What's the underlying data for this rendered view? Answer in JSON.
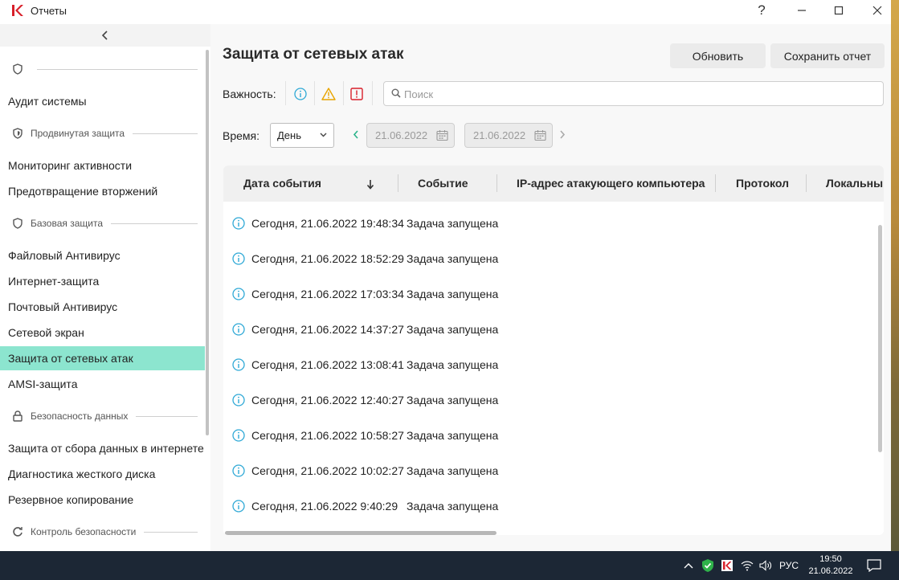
{
  "window": {
    "title": "Отчеты",
    "help": "?",
    "minimize": "—",
    "maximize": "☐",
    "close": "✕"
  },
  "sidebar": {
    "collapse_glyph": "‹",
    "top_section": {
      "label": "",
      "icon": "shield-icon"
    },
    "items": [
      {
        "id": "audit",
        "label": "Аудит системы"
      },
      {
        "id": "section-advanced",
        "section": true,
        "label": "Продвинутая защита",
        "icon": "shield-icon"
      },
      {
        "id": "activity",
        "label": "Мониторинг активности"
      },
      {
        "id": "intrusion",
        "label": "Предотвращение вторжений"
      },
      {
        "id": "section-basic",
        "section": true,
        "label": "Базовая защита",
        "icon": "shield-icon"
      },
      {
        "id": "file-av",
        "label": "Файловый Антивирус"
      },
      {
        "id": "web",
        "label": "Интернет-защита"
      },
      {
        "id": "mail-av",
        "label": "Почтовый Антивирус"
      },
      {
        "id": "firewall",
        "label": "Сетевой экран"
      },
      {
        "id": "network-attack",
        "label": "Защита от сетевых атак",
        "active": true
      },
      {
        "id": "amsi",
        "label": "AMSI-защита"
      },
      {
        "id": "section-data",
        "section": true,
        "label": "Безопасность данных",
        "icon": "lock-icon"
      },
      {
        "id": "data-collection",
        "label": "Защита от сбора данных в интернете"
      },
      {
        "id": "disk",
        "label": "Диагностика жесткого диска"
      },
      {
        "id": "backup",
        "label": "Резервное копирование"
      },
      {
        "id": "section-control",
        "section": true,
        "label": "Контроль безопасности",
        "icon": "refresh-shield-icon"
      }
    ]
  },
  "main": {
    "title": "Защита от сетевых атак",
    "refresh_label": "Обновить",
    "save_report_label": "Сохранить отчет",
    "severity_label": "Важность:",
    "search_placeholder": "Поиск",
    "time_label": "Время:",
    "period_value": "День",
    "date_from": "21.06.2022",
    "date_to": "21.06.2022"
  },
  "table": {
    "columns": [
      "Дата события",
      "Событие",
      "IP-адрес атакующего компьютера",
      "Протокол",
      "Локальный"
    ],
    "rows": [
      {
        "date": "Сегодня, 21.06.2022 19:48:34",
        "event": "Задача запущена"
      },
      {
        "date": "Сегодня, 21.06.2022 18:52:29",
        "event": "Задача запущена"
      },
      {
        "date": "Сегодня, 21.06.2022 17:03:34",
        "event": "Задача запущена"
      },
      {
        "date": "Сегодня, 21.06.2022 14:37:27",
        "event": "Задача запущена"
      },
      {
        "date": "Сегодня, 21.06.2022 13:08:41",
        "event": "Задача запущена"
      },
      {
        "date": "Сегодня, 21.06.2022 12:40:27",
        "event": "Задача запущена"
      },
      {
        "date": "Сегодня, 21.06.2022 10:58:27",
        "event": "Задача запущена"
      },
      {
        "date": "Сегодня, 21.06.2022 10:02:27",
        "event": "Задача запущена"
      },
      {
        "date": "Сегодня, 21.06.2022 9:40:29",
        "event": "Задача запущена"
      }
    ]
  },
  "taskbar": {
    "language": "РУС",
    "time": "19:50",
    "date": "21.06.2022"
  },
  "colors": {
    "active_item": "#8ce5cf",
    "info": "#2fa9d6",
    "warning": "#e8a400",
    "error": "#d81f2a",
    "taskbar": "#1c2735"
  }
}
